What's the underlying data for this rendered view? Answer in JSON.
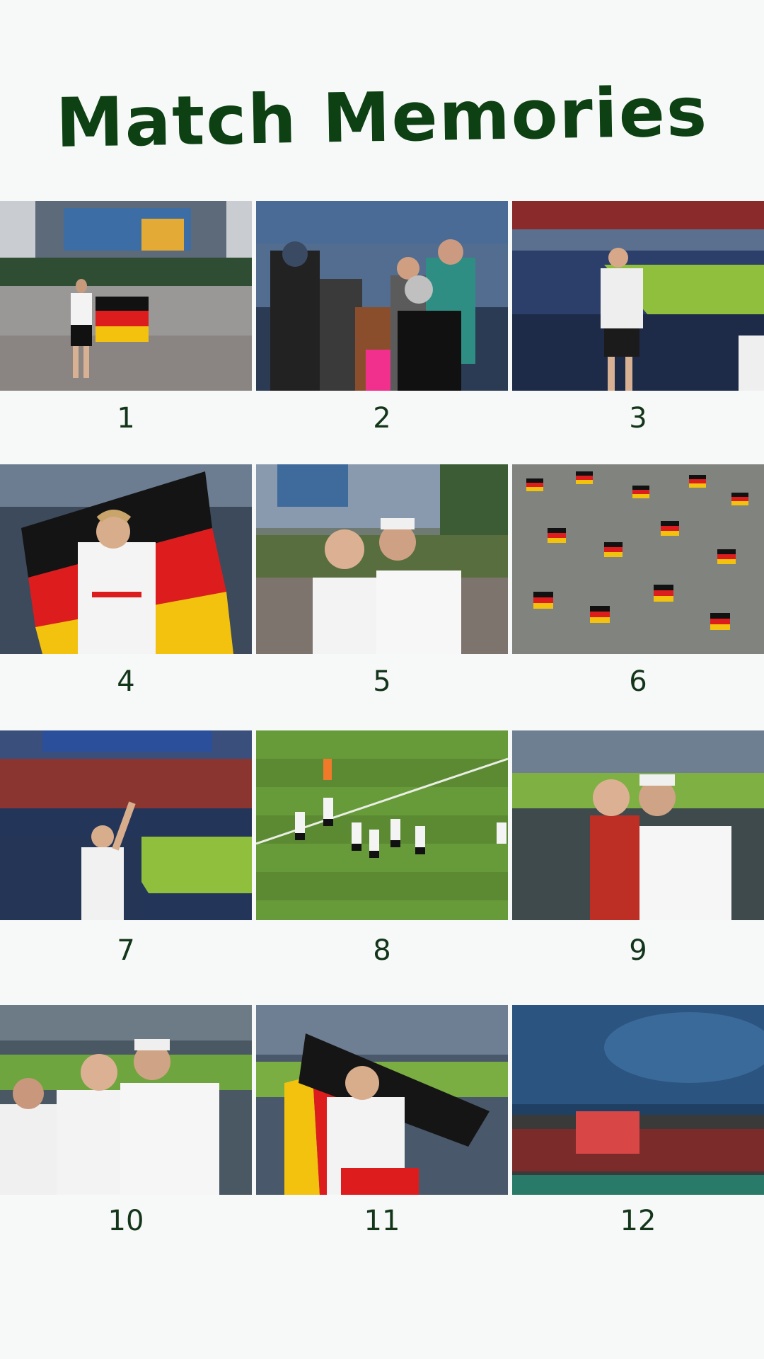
{
  "title": "Match Memories",
  "photos": [
    {
      "number": "1"
    },
    {
      "number": "2"
    },
    {
      "number": "3"
    },
    {
      "number": "4"
    },
    {
      "number": "5"
    },
    {
      "number": "6"
    },
    {
      "number": "7"
    },
    {
      "number": "8"
    },
    {
      "number": "9"
    },
    {
      "number": "10"
    },
    {
      "number": "11"
    },
    {
      "number": "12"
    }
  ],
  "colors": {
    "background": "#f7f9f8",
    "title": "#0d4012",
    "numbers": "#13351a"
  }
}
